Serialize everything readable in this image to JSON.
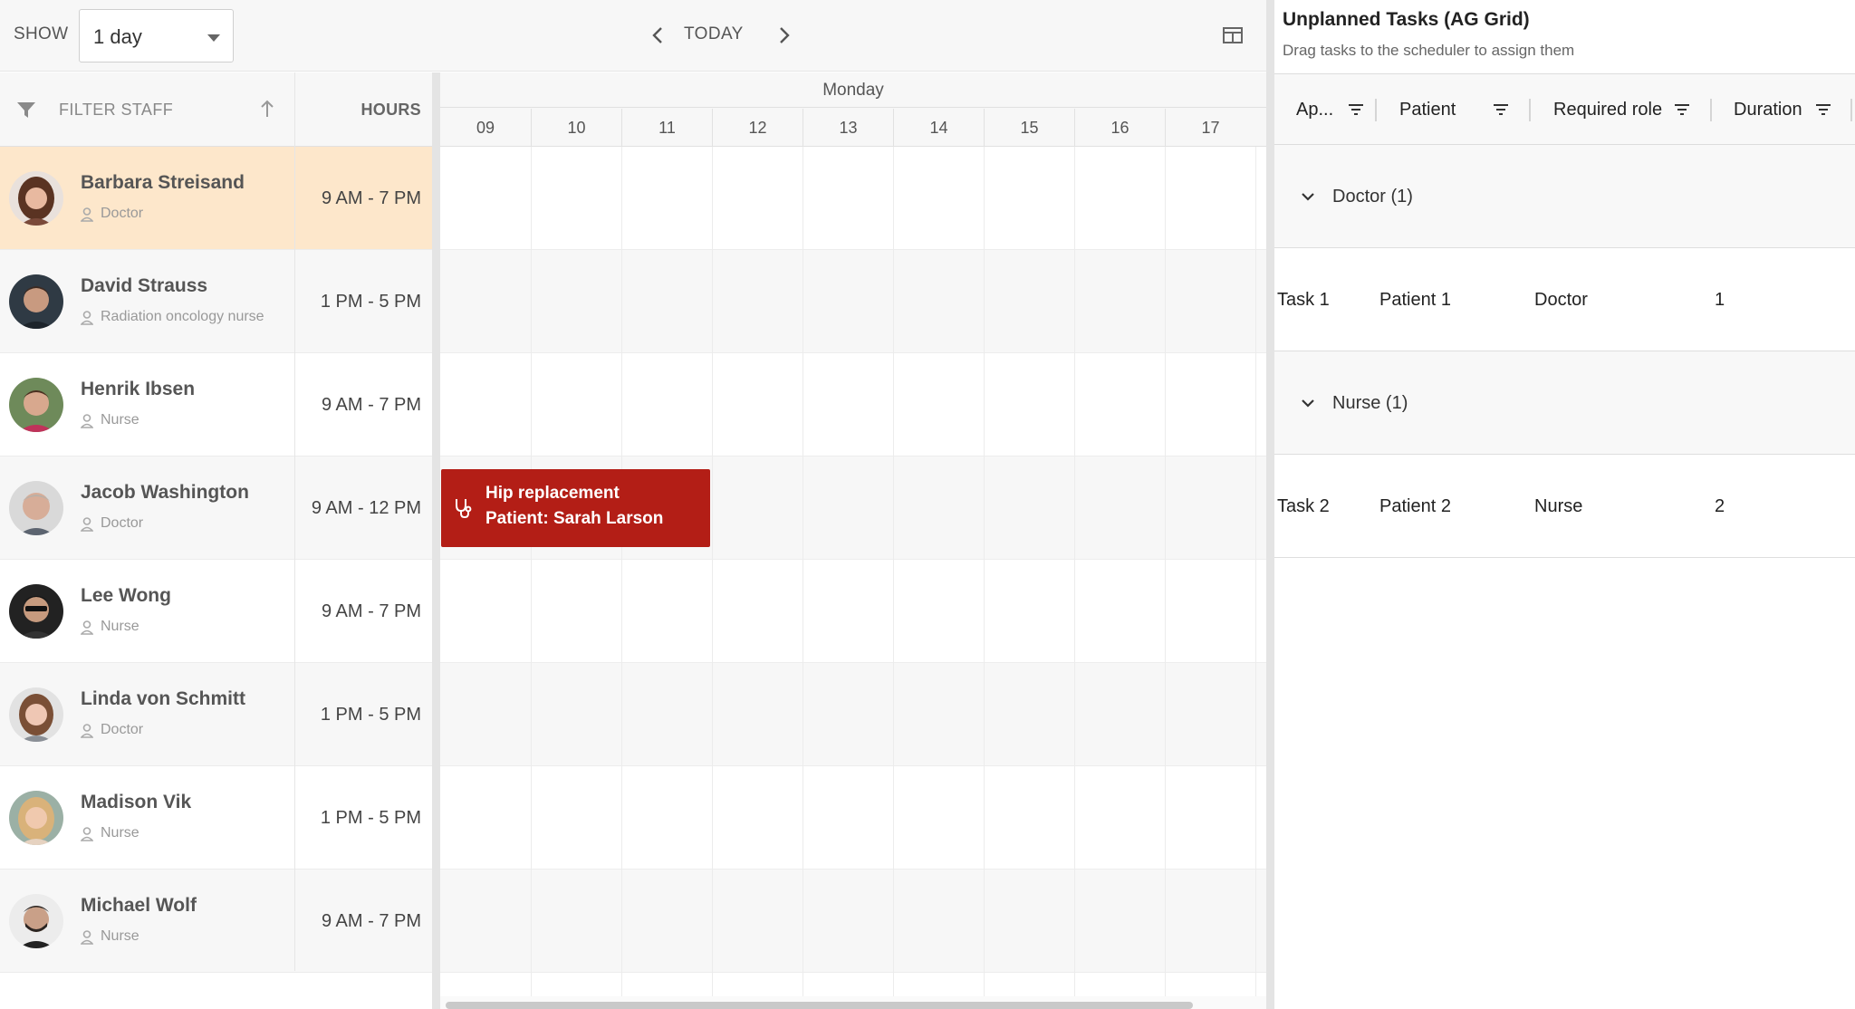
{
  "toolbar": {
    "show_label": "SHOW",
    "range_value": "1 day",
    "today_label": "TODAY"
  },
  "staff_header": {
    "filter_label": "FILTER STAFF",
    "hours_label": "HOURS"
  },
  "timeaxis": {
    "day": "Monday",
    "hours": [
      "09",
      "10",
      "11",
      "12",
      "13",
      "14",
      "15",
      "16",
      "17"
    ]
  },
  "staff": [
    {
      "name": "Barbara Streisand",
      "role": "Doctor",
      "hours": "9 AM - 7 PM"
    },
    {
      "name": "David Strauss",
      "role": "Radiation oncology nurse",
      "hours": "1 PM - 5 PM"
    },
    {
      "name": "Henrik Ibsen",
      "role": "Nurse",
      "hours": "9 AM - 7 PM"
    },
    {
      "name": "Jacob Washington",
      "role": "Doctor",
      "hours": "9 AM - 12 PM"
    },
    {
      "name": "Lee Wong",
      "role": "Nurse",
      "hours": "9 AM - 7 PM"
    },
    {
      "name": "Linda von Schmitt",
      "role": "Doctor",
      "hours": "1 PM - 5 PM"
    },
    {
      "name": "Madison Vik",
      "role": "Nurse",
      "hours": "1 PM - 5 PM"
    },
    {
      "name": "Michael Wolf",
      "role": "Nurse",
      "hours": "9 AM - 7 PM"
    }
  ],
  "event": {
    "title": "Hip replacement",
    "subtitle": "Patient: Sarah Larson",
    "color": "#b31e16",
    "icon": "stethoscope-icon"
  },
  "grid": {
    "title": "Unplanned Tasks (AG Grid)",
    "subtitle": "Drag tasks to the scheduler to assign them",
    "columns": [
      "Ap...",
      "Patient",
      "Required role",
      "Duration"
    ],
    "groups": [
      {
        "label": "Doctor (1)",
        "rows": [
          {
            "task": "Task 1",
            "patient": "Patient 1",
            "role": "Doctor",
            "duration": "1"
          }
        ]
      },
      {
        "label": "Nurse (1)",
        "rows": [
          {
            "task": "Task 2",
            "patient": "Patient 2",
            "role": "Nurse",
            "duration": "2"
          }
        ]
      }
    ]
  },
  "colors": {
    "selected_row": "#fde7cb",
    "alt_row": "#f7f7f7",
    "event": "#b31e16"
  }
}
